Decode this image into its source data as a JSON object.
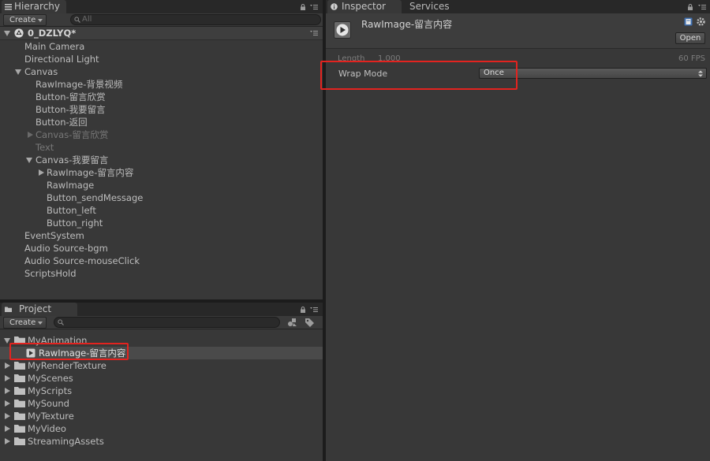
{
  "hierarchy": {
    "tab_label": "Hierarchy",
    "create_label": "Create",
    "search_placeholder": "All",
    "scene_name": "0_DZLYQ*",
    "items": [
      {
        "label": "Main Camera"
      },
      {
        "label": "Directional Light"
      },
      {
        "label": "Canvas"
      },
      {
        "label": "RawImage-背景视频"
      },
      {
        "label": "Button-留言欣赏"
      },
      {
        "label": "Button-我要留言"
      },
      {
        "label": "Button-返回"
      },
      {
        "label": "Canvas-留言欣赏"
      },
      {
        "label": "Text"
      },
      {
        "label": "Canvas-我要留言"
      },
      {
        "label": "RawImage-留言内容"
      },
      {
        "label": "RawImage"
      },
      {
        "label": "Button_sendMessage"
      },
      {
        "label": "Button_left"
      },
      {
        "label": "Button_right"
      },
      {
        "label": "EventSystem"
      },
      {
        "label": "Audio Source-bgm"
      },
      {
        "label": "Audio Source-mouseClick"
      },
      {
        "label": "ScriptsHold"
      }
    ]
  },
  "project": {
    "tab_label": "Project",
    "create_label": "Create",
    "search_placeholder": "",
    "items": [
      {
        "label": "MyAnimation"
      },
      {
        "label": "RawImage-留言内容"
      },
      {
        "label": "MyRenderTexture"
      },
      {
        "label": "MyScenes"
      },
      {
        "label": "MyScripts"
      },
      {
        "label": "MySound"
      },
      {
        "label": "MyTexture"
      },
      {
        "label": "MyVideo"
      },
      {
        "label": "StreamingAssets"
      }
    ]
  },
  "inspector": {
    "tab_label": "Inspector",
    "services_tab_label": "Services",
    "asset_name": "RawImage-留言内容",
    "open_button_label": "Open",
    "length_label": "Length",
    "length_value": "1.000",
    "fps_label": "60 FPS",
    "wrap_mode_label": "Wrap Mode",
    "wrap_mode_value": "Once"
  },
  "colors": {
    "panel_bg": "#383838",
    "highlight": "#e3231f",
    "selected_row": "#4a4a4a"
  }
}
